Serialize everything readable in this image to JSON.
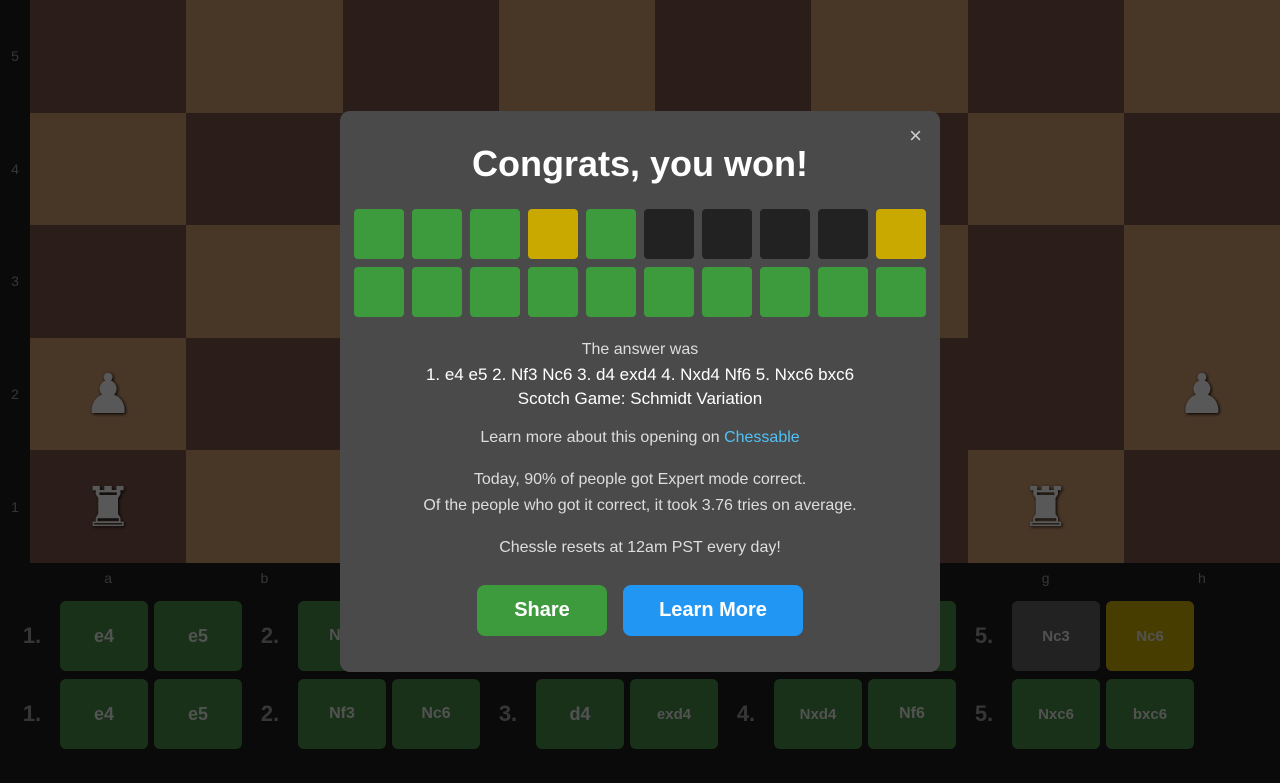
{
  "modal": {
    "title": "Congrats, you won!",
    "close_label": "×",
    "answer_label": "The answer was",
    "answer_moves": "1. e4 e5 2. Nf3 Nc6 3. d4 exd4 4. Nxd4 Nf6 5. Nxc6 bxc6",
    "answer_name": "Scotch Game: Schmidt Variation",
    "learn_text_pre": "Learn more about this opening on ",
    "learn_link_label": "Chessable",
    "stats_line1": "Today, 90% of people got Expert mode correct.",
    "stats_line2": "Of the people who got it correct, it took 3.76 tries on average.",
    "reset_text": "Chessle resets at 12am PST every day!",
    "share_label": "Share",
    "learn_more_label": "Learn More"
  },
  "tile_rows": [
    [
      "green",
      "green",
      "green",
      "yellow",
      "green",
      "black",
      "black",
      "black",
      "black",
      "yellow"
    ],
    [
      "green",
      "green",
      "green",
      "green",
      "green",
      "green",
      "green",
      "green",
      "green",
      "green"
    ]
  ],
  "keyboard": {
    "row1": {
      "num": "1.",
      "moves": [
        "e4",
        "e5"
      ],
      "num2": "2.",
      "moves2": [
        "Nf3",
        "Nc6"
      ],
      "num3": "3.",
      "moves3": [
        "d4",
        "exd4"
      ],
      "num4": "4.",
      "moves4": [
        "Nxd4",
        "Nf6"
      ],
      "num5": "5.",
      "moves5": [
        "Nxc6",
        "bxc6"
      ]
    },
    "row2_num": "1.",
    "row2": [
      "e4",
      "e5"
    ],
    "row2_num2": "2.",
    "row2_b": [
      "Nf3",
      "Nc6"
    ],
    "row2_num3": "3.",
    "row2_c": [
      "d4",
      "exd4"
    ],
    "row2_num4": "4.",
    "row2_d": [
      "Nxd4",
      "Nf6"
    ],
    "row2_num5": "5.",
    "row2_e_gray": "Nc3",
    "row2_e_yellow": "Nc6"
  },
  "colors": {
    "green": "#3d9a3d",
    "yellow": "#c9a800",
    "black": "#222222",
    "gray": "#555555",
    "blue": "#2196f3"
  }
}
